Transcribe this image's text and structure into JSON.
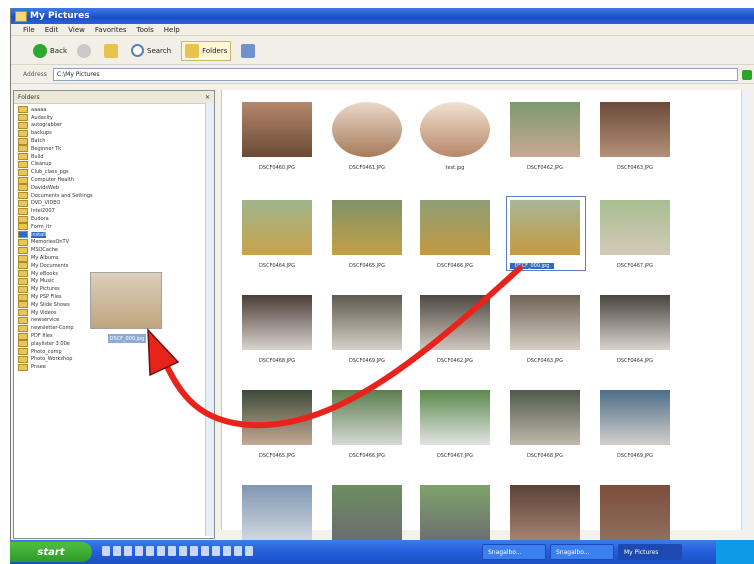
{
  "window": {
    "title": "My Pictures"
  },
  "menubar": [
    "File",
    "Edit",
    "View",
    "Favorites",
    "Tools",
    "Help"
  ],
  "toolbar": {
    "back": "Back",
    "search": "Search",
    "folders": "Folders"
  },
  "address": {
    "label": "Address",
    "value": "C:\\My Pictures"
  },
  "left_panel": {
    "header": "Folders",
    "folders": [
      "aaaaa",
      "Audacity",
      "autograbber",
      "backups",
      "Batch",
      "Beginner Tk",
      "Build",
      "Cleanup",
      "Club_class_pgs",
      "Computer Health",
      "DavidsWeb",
      "Documents and Settings",
      "DVD_VIDEO",
      "Intel2007",
      "Eudora",
      "Form_ltr",
      "install",
      "MemoriesOnTV",
      "MSOCache",
      "My Albums",
      "My Documents",
      "My eBooks",
      "My Music",
      "My Pictures",
      "My PSP Files",
      "My Slide Shows",
      "My Videos",
      "newservice",
      "newsletter-Comp",
      "PDF files",
      "playlister 3.00e",
      "Photo_comp",
      "Photo_Workshop",
      "Pnsee"
    ],
    "selected_index": 16
  },
  "drag": {
    "label": "DSCF_000.jpg"
  },
  "images": [
    {
      "name": "DSCF0460.JPG",
      "top": "#b5876b",
      "bottom": "#6a4a35",
      "round": false
    },
    {
      "name": "DSCF0461.JPG",
      "top": "#e9d8c9",
      "bottom": "#a77b5a",
      "round": true
    },
    {
      "name": "test.jpg",
      "top": "#f1e2d2",
      "bottom": "#b88768",
      "round": true
    },
    {
      "name": "DSCF0462.JPG",
      "top": "#7c9a6e",
      "bottom": "#c9a894",
      "round": false
    },
    {
      "name": "DSCF0463.JPG",
      "top": "#6a4a3a",
      "bottom": "#b59078",
      "round": false
    },
    {
      "name": "DSCF0464.JPG",
      "top": "#9fb58d",
      "bottom": "#c9a24a",
      "round": false
    },
    {
      "name": "DSCF0465.JPG",
      "top": "#7f9368",
      "bottom": "#c4a046",
      "round": false
    },
    {
      "name": "DSCF0466.JPG",
      "top": "#8d9f76",
      "bottom": "#c39840",
      "round": false
    },
    {
      "name": "DSCF_000.jpg",
      "top": "#a8b698",
      "bottom": "#c59a42",
      "round": false,
      "selected": true
    },
    {
      "name": "DSCF0467.JPG",
      "top": "#a7be92",
      "bottom": "#d4c9b8",
      "round": false
    },
    {
      "name": "DSCF0468.JPG",
      "top": "#4a3d36",
      "bottom": "#d9d4cd",
      "round": false
    },
    {
      "name": "DSCF0469.JPG",
      "top": "#5f5a4f",
      "bottom": "#d6d2c9",
      "round": false
    },
    {
      "name": "DSCF0462.JPG",
      "top": "#4d4842",
      "bottom": "#cfc8be",
      "round": false
    },
    {
      "name": "DSCF0463.JPG",
      "top": "#6e6456",
      "bottom": "#d5cfc5",
      "round": false
    },
    {
      "name": "DSCF0464.JPG",
      "top": "#4b4540",
      "bottom": "#d8d3cb",
      "round": false
    },
    {
      "name": "DSCF0465.JPG",
      "top": "#3c4a3a",
      "bottom": "#c5a993",
      "round": false
    },
    {
      "name": "DSCF0466.JPG",
      "top": "#5c7e4e",
      "bottom": "#d6d8d6",
      "round": false
    },
    {
      "name": "DSCF0467.JPG",
      "top": "#5a8a4c",
      "bottom": "#e3e3e3",
      "round": false
    },
    {
      "name": "DSCF0468.JPG",
      "top": "#4f5a4b",
      "bottom": "#c0b8ad",
      "round": false
    },
    {
      "name": "DSCF0469.JPG",
      "top": "#4e6f8a",
      "bottom": "#d2cfcb",
      "round": false
    },
    {
      "name": "",
      "top": "#7f97b3",
      "bottom": "#cfd7de",
      "round": false
    },
    {
      "name": "",
      "top": "#6d8e5e",
      "bottom": "#6a6d70",
      "round": false
    },
    {
      "name": "",
      "top": "#7ea36a",
      "bottom": "#6d6f72",
      "round": false
    },
    {
      "name": "",
      "top": "#5b4238",
      "bottom": "#a58270",
      "round": false
    },
    {
      "name": "",
      "top": "#7c4d3b",
      "bottom": "#8f6f5d",
      "round": false
    }
  ],
  "taskbar": {
    "start": "start",
    "tasks": [
      {
        "label": "Snagalbo...",
        "active": false
      },
      {
        "label": "Snagalbo...",
        "active": false
      },
      {
        "label": "My Pictures",
        "active": true
      }
    ]
  },
  "colors": {
    "selection": "#316ac5",
    "arrow": "#e8231c",
    "xp_blue": "#245edb"
  }
}
